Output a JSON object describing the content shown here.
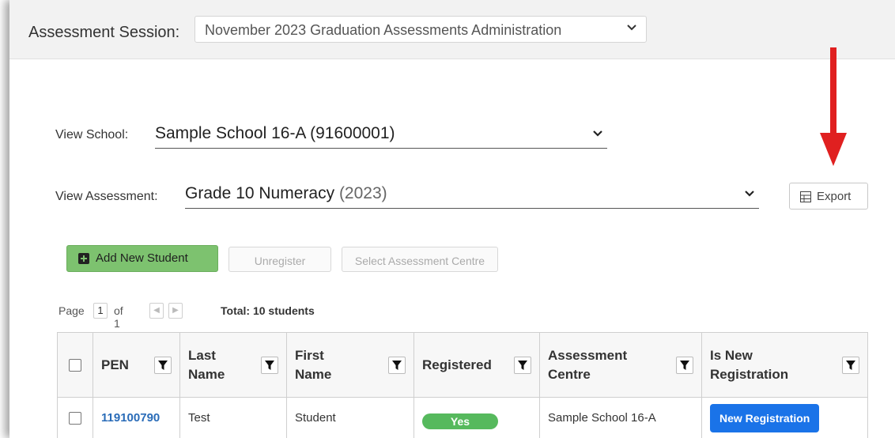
{
  "session": {
    "label": "Assessment Session:",
    "value": "November 2023 Graduation Assessments Administration"
  },
  "school": {
    "label": "View School:",
    "value": "Sample School 16-A (91600001)"
  },
  "assessment": {
    "label": "View Assessment:",
    "value_main": "Grade 10 Numeracy",
    "value_year": "(2023)"
  },
  "toolbar": {
    "export_label": "Export",
    "add_label": "Add New Student",
    "unregister_label": "Unregister",
    "centre_label": "Select Assessment Centre"
  },
  "pager": {
    "page_label": "Page",
    "current_page": "1",
    "of_label": "of 1",
    "total": "Total: 10 students"
  },
  "table": {
    "headers": [
      {
        "line1": "PEN",
        "line2": ""
      },
      {
        "line1": "Last",
        "line2": "Name"
      },
      {
        "line1": "First",
        "line2": "Name"
      },
      {
        "line1": "Registered",
        "line2": ""
      },
      {
        "line1": "Assessment",
        "line2": "Centre"
      },
      {
        "line1": "Is New",
        "line2": "Registration"
      }
    ],
    "rows": [
      {
        "pen": "119100790",
        "last_name": "Test",
        "first_name": "Student",
        "registered": "Yes",
        "centre": "Sample School 16-A",
        "new_registration": "New Registration"
      }
    ]
  },
  "colors": {
    "add_button": "#7dc26f",
    "link": "#2a6cb8",
    "badge_green": "#56b95d",
    "primary_blue": "#1a73e8",
    "annotation_arrow": "#e02020"
  },
  "icons": [
    "chevron-down-icon",
    "table-grid-icon",
    "plus-square-icon",
    "filter-icon",
    "arrow-down-annotation"
  ]
}
